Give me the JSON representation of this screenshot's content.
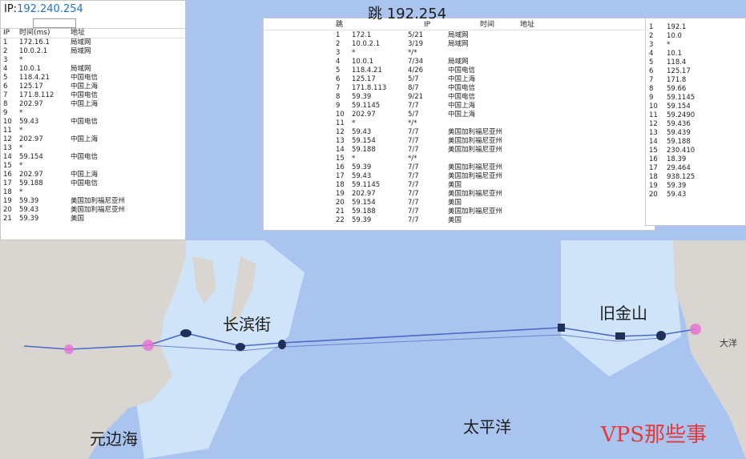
{
  "map": {
    "colors": {
      "sea": "#a9c4ef",
      "sea_light": "#cfe3f9",
      "land": "#d9d6d1",
      "route": "#4a6bc4",
      "hop": "#e76fd3"
    },
    "labels": {
      "upper_center": "长滨街",
      "right": "旧金山",
      "lower_left": "元边海",
      "lower_center": "太平洋",
      "small_right": "大洋"
    }
  },
  "watermark": "VPS那些事",
  "left_window": {
    "title_prefix": "IP:",
    "title_ip": "192.240.254",
    "columns": [
      "IP",
      "时间(ms)",
      "地址"
    ],
    "rows": [
      [
        "1",
        "172.16.1",
        "局域网"
      ],
      [
        "2",
        "10.0.2.1",
        "局域网"
      ],
      [
        "3",
        "*",
        ""
      ],
      [
        "4",
        "10.0.1",
        "局域网"
      ],
      [
        "5",
        "118.4.21",
        "中国电信"
      ],
      [
        "6",
        "125.17",
        "中国上海"
      ],
      [
        "7",
        "171.8.112",
        "中国电信"
      ],
      [
        "8",
        "202.97",
        "中国上海"
      ],
      [
        "9",
        "*",
        ""
      ],
      [
        "10",
        "59.43",
        "中国电信"
      ],
      [
        "11",
        "*",
        ""
      ],
      [
        "12",
        "202.97",
        "中国上海"
      ],
      [
        "13",
        "*",
        ""
      ],
      [
        "14",
        "59.154",
        "中国电信"
      ],
      [
        "15",
        "*",
        ""
      ],
      [
        "16",
        "202.97",
        "中国上海"
      ],
      [
        "17",
        "59.188",
        "中国电信"
      ],
      [
        "18",
        "*",
        ""
      ],
      [
        "19",
        "59.39",
        "美国加利福尼亚州"
      ],
      [
        "20",
        "59.43",
        "美国加利福尼亚州"
      ],
      [
        "21",
        "59.39",
        "美国"
      ]
    ]
  },
  "middle_window": {
    "title": "跳 192.254",
    "columns": [
      "跳",
      "IP",
      "时间",
      "地址"
    ],
    "rows": [
      [
        "1",
        "172.1",
        "5/21",
        "局域网"
      ],
      [
        "2",
        "10.0.2.1",
        "3/19",
        "局域网"
      ],
      [
        "3",
        "*",
        "*/*",
        ""
      ],
      [
        "4",
        "10.0.1",
        "7/34",
        "局域网"
      ],
      [
        "5",
        "118.4.21",
        "4/26",
        "中国电信"
      ],
      [
        "6",
        "125.17",
        "5/7",
        "中国上海"
      ],
      [
        "7",
        "171.8.113",
        "8/7",
        "中国电信"
      ],
      [
        "8",
        "59.39",
        "9/21",
        "中国电信"
      ],
      [
        "9",
        "59.1145",
        "7/7",
        "中国上海"
      ],
      [
        "10",
        "202.97",
        "5/7",
        "中国上海"
      ],
      [
        "11",
        "*",
        "*/*",
        ""
      ],
      [
        "12",
        "59.43",
        "7/7",
        "美国加利福尼亚州"
      ],
      [
        "13",
        "59.154",
        "7/7",
        "美国加利福尼亚州"
      ],
      [
        "14",
        "59.188",
        "7/7",
        "美国加利福尼亚州"
      ],
      [
        "15",
        "*",
        "*/*",
        ""
      ],
      [
        "16",
        "59.39",
        "7/7",
        "美国加利福尼亚州"
      ],
      [
        "17",
        "59.43",
        "7/7",
        "美国加利福尼亚州"
      ],
      [
        "18",
        "59.1145",
        "7/7",
        "美国"
      ],
      [
        "19",
        "202.97",
        "7/7",
        "美国加利福尼亚州"
      ],
      [
        "20",
        "59.154",
        "7/7",
        "美国"
      ],
      [
        "21",
        "59.188",
        "7/7",
        "美国加利福尼亚州"
      ],
      [
        "22",
        "59.39",
        "7/7",
        "美国"
      ]
    ]
  },
  "right_window": {
    "rows": [
      [
        "1",
        "192.1"
      ],
      [
        "2",
        "10.0"
      ],
      [
        "3",
        "*"
      ],
      [
        "4",
        "10.1"
      ],
      [
        "5",
        "118.4"
      ],
      [
        "6",
        "125.17"
      ],
      [
        "7",
        "171.8"
      ],
      [
        "8",
        "59.66"
      ],
      [
        "9",
        "59.1145"
      ],
      [
        "10",
        "59.154"
      ],
      [
        "11",
        "59.2490"
      ],
      [
        "12",
        "59.436"
      ],
      [
        "13",
        "59.439"
      ],
      [
        "14",
        "59.188"
      ],
      [
        "15",
        "230.410"
      ],
      [
        "16",
        "18.39"
      ],
      [
        "17",
        "29.464"
      ],
      [
        "18",
        "938.125"
      ],
      [
        "19",
        "59.39"
      ],
      [
        "20",
        "59.43"
      ]
    ]
  }
}
